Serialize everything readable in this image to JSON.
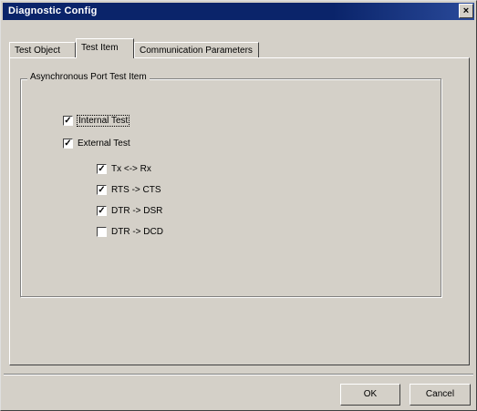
{
  "window": {
    "title": "Diagnostic Config",
    "close_glyph": "×"
  },
  "tabs": [
    {
      "label": "Test Object",
      "active": false
    },
    {
      "label": "Test Item",
      "active": true
    },
    {
      "label": "Communication Parameters",
      "active": false
    }
  ],
  "group": {
    "legend": "Asynchronous Port Test Item",
    "items": [
      {
        "label": "Internal Test",
        "checked": true,
        "check_glyph": "✓"
      },
      {
        "label": "External Test",
        "checked": true,
        "check_glyph": "✓"
      },
      {
        "label": "Tx <-> Rx",
        "checked": true,
        "check_glyph": "✓"
      },
      {
        "label": "RTS -> CTS",
        "checked": true,
        "check_glyph": "✓"
      },
      {
        "label": "DTR -> DSR",
        "checked": true,
        "check_glyph": "✓"
      },
      {
        "label": "DTR -> DCD",
        "checked": false,
        "check_glyph": ""
      }
    ]
  },
  "buttons": {
    "ok": "OK",
    "cancel": "Cancel"
  }
}
